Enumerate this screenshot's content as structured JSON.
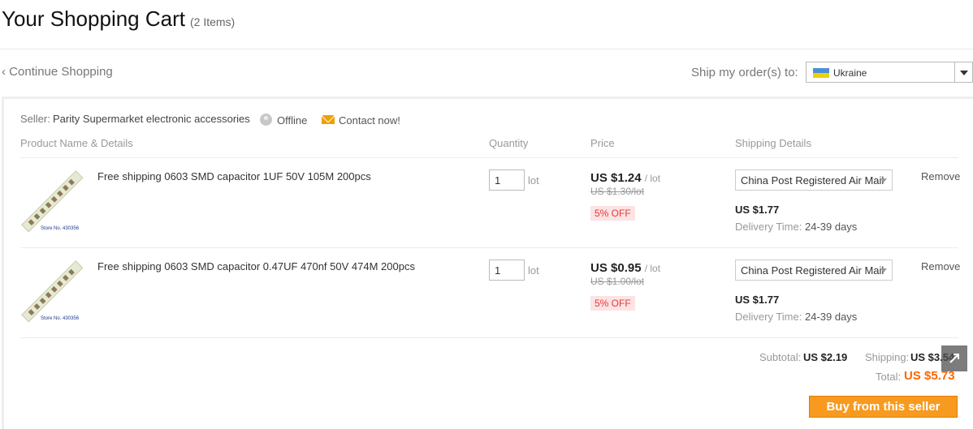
{
  "page": {
    "title": "Your Shopping Cart",
    "item_count": "(2 Items)"
  },
  "nav": {
    "continue_shopping": "Continue Shopping",
    "ship_to_label": "Ship my order(s) to:",
    "ship_to_country": "Ukraine"
  },
  "seller": {
    "label": "Seller:",
    "name": "Parity Supermarket electronic accessories",
    "status": "Offline",
    "contact": "Contact now!"
  },
  "table": {
    "headers": {
      "product": "Product Name & Details",
      "quantity": "Quantity",
      "price": "Price",
      "shipping": "Shipping Details"
    }
  },
  "items": [
    {
      "name": "Free shipping 0603 SMD capacitor 1UF 50V 105M 200pcs",
      "quantity": "1",
      "unit": "lot",
      "price": "US $1.24",
      "per_unit": "/ lot",
      "old_price": "US $1.30/lot",
      "discount": "5% OFF",
      "shipping_method": "China Post Registered Air Mail",
      "shipping_cost": "US $1.77",
      "delivery_label": "Delivery Time:",
      "delivery_time": "24-39 days",
      "remove": "Remove",
      "thumb_caption": "Store No. 430356"
    },
    {
      "name": "Free shipping 0603 SMD capacitor 0.47UF 470nf 50V 474M 200pcs",
      "quantity": "1",
      "unit": "lot",
      "price": "US $0.95",
      "per_unit": "/ lot",
      "old_price": "US $1.00/lot",
      "discount": "5% OFF",
      "shipping_method": "China Post Registered Air Mail",
      "shipping_cost": "US $1.77",
      "delivery_label": "Delivery Time:",
      "delivery_time": "24-39 days",
      "remove": "Remove",
      "thumb_caption": "Store No. 430356"
    }
  ],
  "summary": {
    "subtotal_label": "Subtotal:",
    "subtotal": "US $2.19",
    "shipping_label": "Shipping:",
    "shipping": "US $3.54",
    "total_label": "Total:",
    "total": "US $5.73"
  },
  "actions": {
    "buy": "Buy from this seller"
  },
  "colors": {
    "accent_orange": "#f79a1f",
    "total_orange": "#ff6600",
    "discount_red": "#e4393c",
    "discount_bg": "#fde3e3"
  }
}
